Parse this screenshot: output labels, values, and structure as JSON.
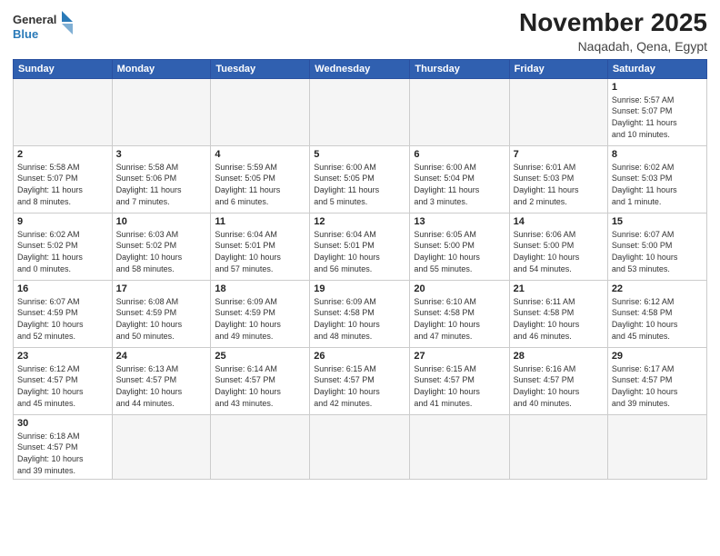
{
  "logo": {
    "text_general": "General",
    "text_blue": "Blue"
  },
  "header": {
    "month": "November 2025",
    "location": "Naqadah, Qena, Egypt"
  },
  "weekdays": [
    "Sunday",
    "Monday",
    "Tuesday",
    "Wednesday",
    "Thursday",
    "Friday",
    "Saturday"
  ],
  "weeks": [
    [
      {
        "day": "",
        "info": ""
      },
      {
        "day": "",
        "info": ""
      },
      {
        "day": "",
        "info": ""
      },
      {
        "day": "",
        "info": ""
      },
      {
        "day": "",
        "info": ""
      },
      {
        "day": "",
        "info": ""
      },
      {
        "day": "1",
        "info": "Sunrise: 5:57 AM\nSunset: 5:07 PM\nDaylight: 11 hours\nand 10 minutes."
      }
    ],
    [
      {
        "day": "2",
        "info": "Sunrise: 5:58 AM\nSunset: 5:07 PM\nDaylight: 11 hours\nand 8 minutes."
      },
      {
        "day": "3",
        "info": "Sunrise: 5:58 AM\nSunset: 5:06 PM\nDaylight: 11 hours\nand 7 minutes."
      },
      {
        "day": "4",
        "info": "Sunrise: 5:59 AM\nSunset: 5:05 PM\nDaylight: 11 hours\nand 6 minutes."
      },
      {
        "day": "5",
        "info": "Sunrise: 6:00 AM\nSunset: 5:05 PM\nDaylight: 11 hours\nand 5 minutes."
      },
      {
        "day": "6",
        "info": "Sunrise: 6:00 AM\nSunset: 5:04 PM\nDaylight: 11 hours\nand 3 minutes."
      },
      {
        "day": "7",
        "info": "Sunrise: 6:01 AM\nSunset: 5:03 PM\nDaylight: 11 hours\nand 2 minutes."
      },
      {
        "day": "8",
        "info": "Sunrise: 6:02 AM\nSunset: 5:03 PM\nDaylight: 11 hours\nand 1 minute."
      }
    ],
    [
      {
        "day": "9",
        "info": "Sunrise: 6:02 AM\nSunset: 5:02 PM\nDaylight: 11 hours\nand 0 minutes."
      },
      {
        "day": "10",
        "info": "Sunrise: 6:03 AM\nSunset: 5:02 PM\nDaylight: 10 hours\nand 58 minutes."
      },
      {
        "day": "11",
        "info": "Sunrise: 6:04 AM\nSunset: 5:01 PM\nDaylight: 10 hours\nand 57 minutes."
      },
      {
        "day": "12",
        "info": "Sunrise: 6:04 AM\nSunset: 5:01 PM\nDaylight: 10 hours\nand 56 minutes."
      },
      {
        "day": "13",
        "info": "Sunrise: 6:05 AM\nSunset: 5:00 PM\nDaylight: 10 hours\nand 55 minutes."
      },
      {
        "day": "14",
        "info": "Sunrise: 6:06 AM\nSunset: 5:00 PM\nDaylight: 10 hours\nand 54 minutes."
      },
      {
        "day": "15",
        "info": "Sunrise: 6:07 AM\nSunset: 5:00 PM\nDaylight: 10 hours\nand 53 minutes."
      }
    ],
    [
      {
        "day": "16",
        "info": "Sunrise: 6:07 AM\nSunset: 4:59 PM\nDaylight: 10 hours\nand 52 minutes."
      },
      {
        "day": "17",
        "info": "Sunrise: 6:08 AM\nSunset: 4:59 PM\nDaylight: 10 hours\nand 50 minutes."
      },
      {
        "day": "18",
        "info": "Sunrise: 6:09 AM\nSunset: 4:59 PM\nDaylight: 10 hours\nand 49 minutes."
      },
      {
        "day": "19",
        "info": "Sunrise: 6:09 AM\nSunset: 4:58 PM\nDaylight: 10 hours\nand 48 minutes."
      },
      {
        "day": "20",
        "info": "Sunrise: 6:10 AM\nSunset: 4:58 PM\nDaylight: 10 hours\nand 47 minutes."
      },
      {
        "day": "21",
        "info": "Sunrise: 6:11 AM\nSunset: 4:58 PM\nDaylight: 10 hours\nand 46 minutes."
      },
      {
        "day": "22",
        "info": "Sunrise: 6:12 AM\nSunset: 4:58 PM\nDaylight: 10 hours\nand 45 minutes."
      }
    ],
    [
      {
        "day": "23",
        "info": "Sunrise: 6:12 AM\nSunset: 4:57 PM\nDaylight: 10 hours\nand 45 minutes."
      },
      {
        "day": "24",
        "info": "Sunrise: 6:13 AM\nSunset: 4:57 PM\nDaylight: 10 hours\nand 44 minutes."
      },
      {
        "day": "25",
        "info": "Sunrise: 6:14 AM\nSunset: 4:57 PM\nDaylight: 10 hours\nand 43 minutes."
      },
      {
        "day": "26",
        "info": "Sunrise: 6:15 AM\nSunset: 4:57 PM\nDaylight: 10 hours\nand 42 minutes."
      },
      {
        "day": "27",
        "info": "Sunrise: 6:15 AM\nSunset: 4:57 PM\nDaylight: 10 hours\nand 41 minutes."
      },
      {
        "day": "28",
        "info": "Sunrise: 6:16 AM\nSunset: 4:57 PM\nDaylight: 10 hours\nand 40 minutes."
      },
      {
        "day": "29",
        "info": "Sunrise: 6:17 AM\nSunset: 4:57 PM\nDaylight: 10 hours\nand 39 minutes."
      }
    ],
    [
      {
        "day": "30",
        "info": "Sunrise: 6:18 AM\nSunset: 4:57 PM\nDaylight: 10 hours\nand 39 minutes."
      },
      {
        "day": "",
        "info": ""
      },
      {
        "day": "",
        "info": ""
      },
      {
        "day": "",
        "info": ""
      },
      {
        "day": "",
        "info": ""
      },
      {
        "day": "",
        "info": ""
      },
      {
        "day": "",
        "info": ""
      }
    ]
  ]
}
